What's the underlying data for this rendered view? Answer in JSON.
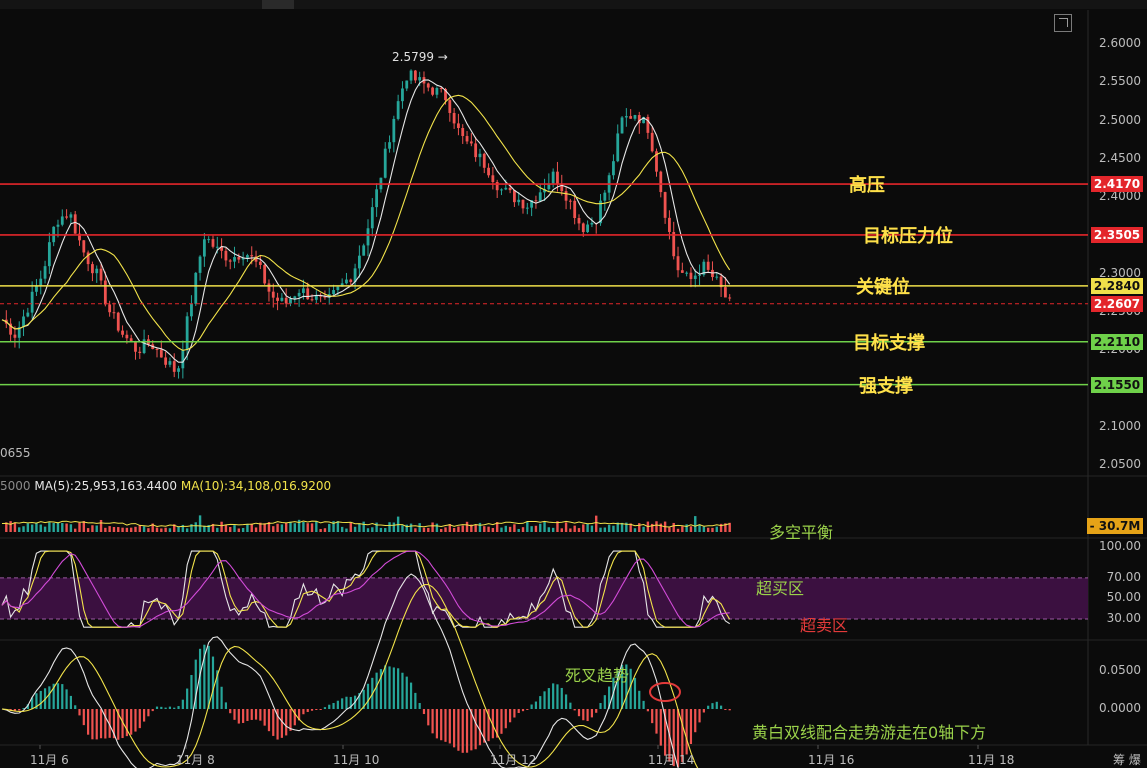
{
  "chart_data": {
    "type": "line",
    "title": "",
    "price_axis_ticks": [
      "2.6000",
      "2.5500",
      "2.5000",
      "2.4500",
      "2.4000",
      "2.3500",
      "2.3000",
      "2.2500",
      "2.2000",
      "2.1500",
      "2.1000",
      "2.0500"
    ],
    "x_axis_labels": [
      "11月 6",
      "11月 8",
      "11月 10",
      "11月 12",
      "11月 14",
      "11月 16",
      "11月 18"
    ],
    "high_marker": "2.5799 →",
    "left_cut_value": "0655",
    "current_price": "2.2607",
    "price_series": [
      2.24,
      2.22,
      2.26,
      2.3,
      2.37,
      2.38,
      2.33,
      2.3,
      2.25,
      2.22,
      2.2,
      2.21,
      2.19,
      2.17,
      2.26,
      2.35,
      2.33,
      2.32,
      2.33,
      2.31,
      2.27,
      2.26,
      2.28,
      2.27,
      2.26,
      2.28,
      2.3,
      2.35,
      2.42,
      2.5,
      2.56,
      2.55,
      2.54,
      2.53,
      2.48,
      2.46,
      2.44,
      2.41,
      2.4,
      2.39,
      2.41,
      2.43,
      2.4,
      2.36,
      2.37,
      2.42,
      2.5,
      2.51,
      2.49,
      2.4,
      2.31,
      2.29,
      2.31,
      2.29,
      2.26
    ],
    "levels": [
      {
        "name": "高压",
        "value": "2.4170",
        "color": "#e3262b",
        "text_color": "#ffffff",
        "label_color": "#ffe14a"
      },
      {
        "name": "目标压力位",
        "value": "2.3505",
        "color": "#e3262b",
        "text_color": "#ffffff",
        "label_color": "#ffe14a"
      },
      {
        "name": "关键位",
        "value": "2.2840",
        "color": "#f0e04a",
        "text_color": "#111111",
        "label_color": "#ffe14a"
      },
      {
        "name": "目标支撑",
        "value": "2.2110",
        "color": "#6fd14a",
        "text_color": "#111111",
        "label_color": "#ffe14a"
      },
      {
        "name": "强支撑",
        "value": "2.1550",
        "color": "#6fd14a",
        "text_color": "#111111",
        "label_color": "#ffe14a"
      }
    ],
    "volume": {
      "left_cut_value": "5000",
      "ma5": "MA(5):25,953,163.4400",
      "ma10": "MA(10):34,108,016.9200",
      "last_value": "30.7M",
      "annotation": "多空平衡"
    },
    "rsi": {
      "ticks": [
        "100.00",
        "70.00",
        "50.00",
        "30.00"
      ],
      "overbought_label": "超买区",
      "oversold_label": "超卖区"
    },
    "macd": {
      "ticks": [
        "0.0500",
        "0.0000"
      ],
      "cross_label": "死叉趋势",
      "trend_label": "黄白双线配合走势游走在0轴下方"
    },
    "colors": {
      "up": "#26a69a",
      "down": "#ef5350",
      "ma_white": "#e6e6e6",
      "ma_yellow": "#f2e34a",
      "rsi_band": "#3b1040",
      "magenta": "#d24bd8",
      "note_green": "#9ad14a",
      "note_red": "#e23a3a"
    }
  },
  "toolbar": {
    "corner_text": "筹 爆"
  }
}
